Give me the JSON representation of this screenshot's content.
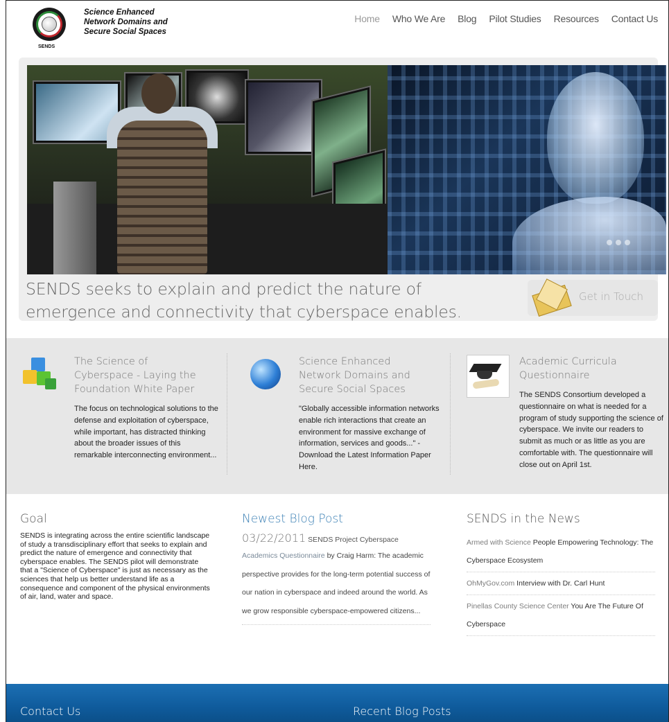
{
  "header": {
    "logo_lines": [
      "Science Enhanced",
      "Network Domains and",
      "Secure Social Spaces"
    ],
    "logo_subtitle": "SENDS",
    "nav": [
      {
        "label": "Home",
        "active": true
      },
      {
        "label": "Who We Are",
        "active": false
      },
      {
        "label": "Blog",
        "active": false
      },
      {
        "label": "Pilot Studies",
        "active": false
      },
      {
        "label": "Resources",
        "active": false
      },
      {
        "label": "Contact Us",
        "active": false
      }
    ]
  },
  "hero": {
    "tagline_line1": "SENDS seeks to explain and predict the nature of",
    "tagline_line2": "emergence and connectivity that cyberspace enables.",
    "cta_label": "Get in Touch",
    "slide_count": 3
  },
  "features": [
    {
      "icon": "cubes-icon",
      "title_lines": [
        "The Science of",
        "Cyberspace - Laying the",
        "Foundation White Paper"
      ],
      "text": "The focus on technological solutions to the defense and exploitation of cyberspace, while important, has distracted thinking about the broader issues of this remarkable interconnecting environment..."
    },
    {
      "icon": "globe-icon",
      "title_lines": [
        "Science Enhanced",
        "Network Domains and",
        "Secure Social Spaces"
      ],
      "text": "\"Globally accessible information networks enable rich interactions that create an environment for massive exchange of information, services and goods...\" - Download the Latest Information Paper Here."
    },
    {
      "icon": "graduation-cap-icon",
      "title_lines": [
        "Academic Curricula",
        "Questionnaire"
      ],
      "text": "The SENDS Consortium developed a questionnaire on what is needed for a program of study supporting the science of cyberspace. We invite our readers to submit as much or as little as you are comfortable with. The questionnaire will close out on April 1st."
    }
  ],
  "goal": {
    "heading": "Goal",
    "text": "SENDS is integrating across the entire scientific landscape of study a transdisciplinary effort that seeks to explain and predict the nature of emergence and connectivity that cyberspace enables. The SENDS pilot will demonstrate that a \"Science of Cyberspace\" is just as necessary as the sciences that help us better understand life as a consequence and component of the physical environments of air, land, water and space."
  },
  "blog": {
    "heading": "Newest Blog Post",
    "date": "03/22/2011",
    "title": "SENDS Project Cyberspace",
    "link_text": "Academics Questionnaire",
    "text": "by Craig Harm: The academic perspective provides for the long-term potential success of our nation in cyberspace and indeed around the world. As we grow responsible cyberspace-empowered citizens..."
  },
  "news": {
    "heading": "SENDS in the News",
    "items": [
      {
        "source": "Armed with Science",
        "title": "People Empowering Technology: The Cyberspace Ecosystem"
      },
      {
        "source": "OhMyGov.com",
        "title": "Interview with Dr. Carl Hunt"
      },
      {
        "source": "Pinellas County Science Center",
        "title": "You Are The Future Of Cyberspace"
      }
    ]
  },
  "footer": {
    "contact_heading": "Contact Us",
    "recent_heading": "Recent Blog Posts"
  }
}
